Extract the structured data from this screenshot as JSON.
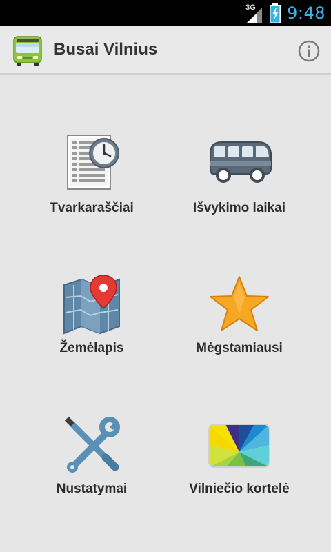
{
  "status_bar": {
    "network": "3G",
    "time": "9:48",
    "accent_color": "#33b5e5"
  },
  "action_bar": {
    "title": "Busai Vilnius",
    "app_icon": "bus-icon",
    "info_icon": "info-icon"
  },
  "menu": {
    "items": [
      {
        "label": "Tvarkaraščiai",
        "icon": "timetable-clock-icon"
      },
      {
        "label": "Išvykimo laikai",
        "icon": "bus-icon"
      },
      {
        "label": "Žemėlapis",
        "icon": "map-pin-icon"
      },
      {
        "label": "Mėgstamiausi",
        "icon": "star-icon"
      },
      {
        "label": "Nustatymai",
        "icon": "wrench-screwdriver-icon"
      },
      {
        "label": "Vilniečio kortelė",
        "icon": "card-icon"
      }
    ]
  }
}
